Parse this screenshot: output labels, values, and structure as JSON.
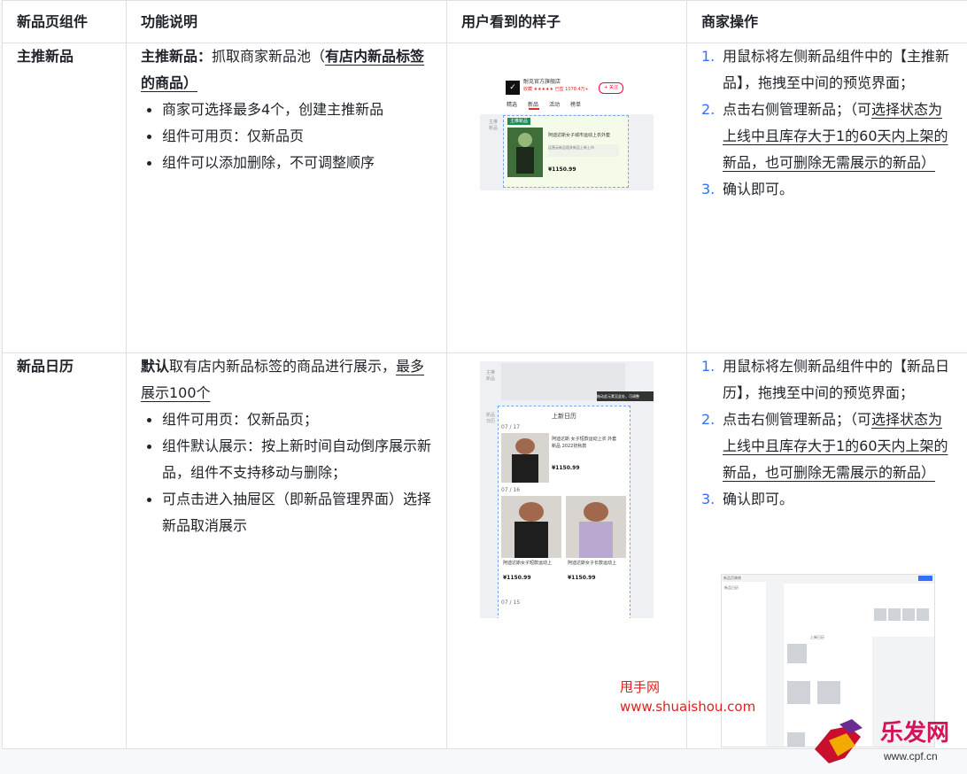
{
  "table": {
    "headers": [
      "新品页组件",
      "功能说明",
      "用户看到的样子",
      "商家操作"
    ],
    "row1": {
      "name": "主推新品",
      "intro_bold": "主推新品：",
      "intro_text": "抓取商家新品池（",
      "intro_underlined": "有店内新品标签的商品）",
      "bullets": [
        "商家可选择最多4个，创建主推新品",
        "组件可用页：仅新品页",
        "组件可以添加删除，不可调整顺序"
      ],
      "steps": [
        {
          "num": "1.",
          "parts": [
            "用鼠标将左侧新品组件中的【主推新品】，拖拽至中间的预览界面；"
          ]
        },
        {
          "num": "2.",
          "plain": "点击右侧管理新品；（可",
          "underlined": "选择状态为上线中且库存大于1的60天内上架的新品，也可删除无需展示的新品）"
        },
        {
          "num": "3.",
          "parts": [
            "确认即可。"
          ]
        }
      ]
    },
    "row2": {
      "name": "新品日历",
      "intro_bold": "默认",
      "intro_text": "取有店内新品标签的商品进行展示，",
      "intro_underlined": "最多展示100个",
      "bullets": [
        "组件可用页：仅新品页；",
        "组件默认展示：按上新时间自动倒序展示新品，组件不支持移动与删除；",
        "可点击进入抽屉区（即新品管理界面）选择新品取消展示"
      ],
      "steps": [
        {
          "num": "1.",
          "parts": [
            "用鼠标将左侧新品组件中的【新品日历】，拖拽至中间的预览界面；"
          ]
        },
        {
          "num": "2.",
          "plain": "点击右侧管理新品；（可",
          "underlined": "选择状态为上线中且库存大于1的60天内上架的新品，也可删除无需展示的新品）"
        },
        {
          "num": "3.",
          "parts": [
            "确认即可。"
          ]
        }
      ]
    }
  },
  "shot1": {
    "store_name": "耐克官方旗舰店",
    "store_sub": "收藏 ★★★★★ 已售 1078.4万+",
    "follow": "+ 关注",
    "tabs": [
      "精选",
      "新品",
      "活动",
      "榜单"
    ],
    "badge": "主推新品",
    "side_label": "主推新品",
    "product_title": "阿迪达斯女子城市运动上衣外套",
    "product_desc": "运营云新品相关新品上新上市",
    "price": "¥1150.99"
  },
  "shot2": {
    "side_label_1": "主推新品",
    "side_label_2": "新品日历",
    "tooltip": "拖动此元素至此处，可调整",
    "calendar_title": "上新日历",
    "date1": "07 / 17",
    "date2": "07 / 16",
    "date3": "07 / 15",
    "item1_title": "阿迪达斯 女子短款运动上衣 外套",
    "item1_sub": "新品 2022初秋款",
    "item2_title": "阿迪达斯女子短款运动上",
    "item3_title": "阿迪达斯女子长款运动上",
    "price1": "¥1150.99",
    "price2": "¥1150.99",
    "price3": "¥1150.99"
  },
  "shot3": {
    "tiny_text_1": "新品页装修",
    "tiny_text_2": "新品日历",
    "tiny_text_3": "上新日历"
  },
  "watermark": {
    "line1": "甩手网",
    "line2": "www.shuaishou.com",
    "logo_text": "乐发网",
    "logo_url": "www.cpf.cn"
  },
  "colors": {
    "accent": "#3370ff",
    "watermark": "#e02020"
  }
}
